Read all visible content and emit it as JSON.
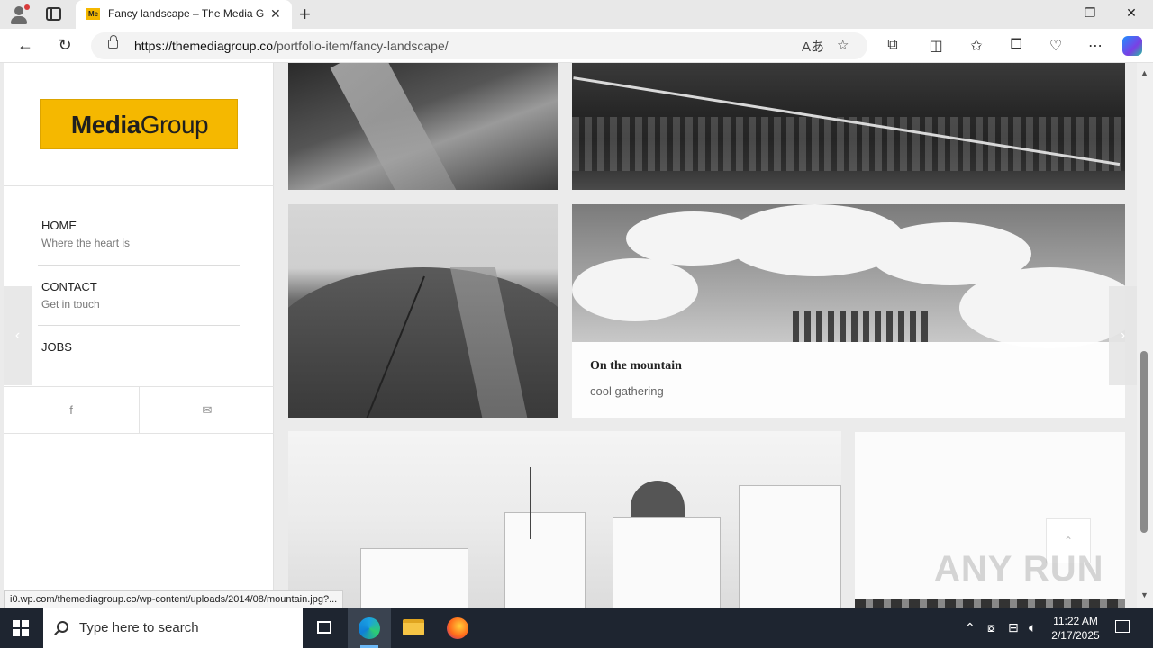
{
  "browser": {
    "tab_title": "Fancy landscape – The Media Group",
    "favicon_text": "Me",
    "url_host": "https://themediagroup.co",
    "url_path": "/portfolio-item/fancy-landscape/",
    "status_url": "i0.wp.com/themediagroup.co/wp-content/uploads/2014/08/mountain.jpg?...",
    "icons": {
      "back": "back-arrow-icon",
      "reload": "reload-icon",
      "read_aloud": "read-aloud-icon",
      "favorite": "star-icon",
      "extensions": "puzzle-icon",
      "split": "split-screen-icon",
      "favorites": "favorites-icon",
      "collections": "collections-icon",
      "performance": "heart-pulse-icon",
      "menu": "more-icon",
      "copilot": "copilot-icon"
    }
  },
  "sidebar": {
    "logo_bold": "Media",
    "logo_light": "Group",
    "menu": [
      {
        "title": "HOME",
        "subtitle": "Where the heart is"
      },
      {
        "title": "CONTACT",
        "subtitle": "Get in touch"
      },
      {
        "title": "JOBS",
        "subtitle": ""
      }
    ],
    "social": [
      "f",
      "✉"
    ]
  },
  "gallery": {
    "caption_title": "On the mountain",
    "caption_subtitle": "cool gathering",
    "prev_arrow": "‹",
    "next_arrow": "›",
    "back_to_top": "⌃"
  },
  "watermark": "ANY RUN",
  "taskbar": {
    "search_placeholder": "Type here to search",
    "time": "11:22 AM",
    "date": "2/17/2025",
    "tray_icons": [
      "chevron-up-icon",
      "meet-now-icon",
      "network-icon",
      "volume-icon"
    ]
  },
  "colors": {
    "brand_yellow": "#f5b800",
    "taskbar_bg": "#1e2530",
    "page_bg": "#ebebeb"
  }
}
